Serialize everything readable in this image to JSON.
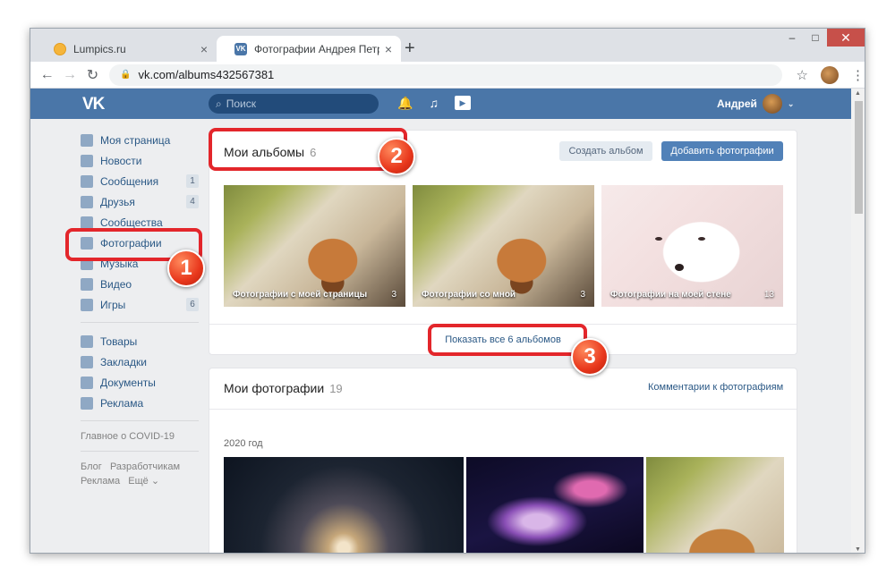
{
  "browser": {
    "tabs": [
      {
        "title": "Lumpics.ru",
        "close": "×"
      },
      {
        "title": "Фотографии Андрея Петрова –",
        "close": "×"
      }
    ],
    "new_tab": "+",
    "window_controls": {
      "minimize": "–",
      "maximize": "□",
      "close": "✕"
    },
    "address": "vk.com/albums432567381"
  },
  "vk": {
    "logo": "VK",
    "search_placeholder": "Поиск",
    "user_name": "Андрей"
  },
  "sidebar": {
    "items": [
      {
        "label": "Моя страница"
      },
      {
        "label": "Новости"
      },
      {
        "label": "Сообщения",
        "badge": "1"
      },
      {
        "label": "Друзья",
        "badge": "4"
      },
      {
        "label": "Сообщества"
      },
      {
        "label": "Фотографии"
      },
      {
        "label": "Музыка"
      },
      {
        "label": "Видео"
      },
      {
        "label": "Игры",
        "badge": "6"
      }
    ],
    "items2": [
      {
        "label": "Товары"
      },
      {
        "label": "Закладки"
      },
      {
        "label": "Документы"
      },
      {
        "label": "Реклама"
      }
    ],
    "covid": "Главное о COVID-19",
    "footer": {
      "blog": "Блог",
      "devs": "Разработчикам",
      "ads": "Реклама",
      "more": "Ещё ⌄"
    }
  },
  "albums": {
    "title": "Мои альбомы",
    "count": "6",
    "create_button": "Создать альбом",
    "add_button": "Добавить фотографии",
    "items": [
      {
        "name": "Фотографии с моей страницы",
        "count": "3"
      },
      {
        "name": "Фотографии со мной",
        "count": "3"
      },
      {
        "name": "Фотографии на моей стене",
        "count": "13"
      }
    ],
    "show_all": "Показать все 6 альбомов"
  },
  "photos": {
    "title": "Мои фотографии",
    "count": "19",
    "comments_link": "Комментарии к фотографиям",
    "year": "2020 год"
  },
  "annotations": {
    "n1": "1",
    "n2": "2",
    "n3": "3"
  },
  "colors": {
    "vk_header": "#4a76a8",
    "link": "#2a5885",
    "primary_button": "#5181b8",
    "annotation": "#e3262b"
  }
}
